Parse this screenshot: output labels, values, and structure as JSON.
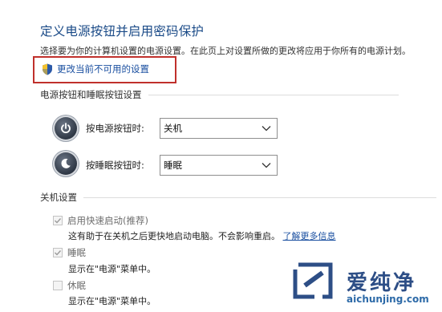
{
  "header": {
    "title": "定义电源按钮并启用密码保护",
    "subtitle": "选择要为你的计算机设置的电源设置。在此页上对设置所做的更改将应用于你所有的电源计划。",
    "change_link": "更改当前不可用的设置"
  },
  "power_buttons": {
    "section_title": "电源按钮和睡眠按钮设置",
    "rows": [
      {
        "label": "按电源按钮时:",
        "value": "关机"
      },
      {
        "label": "按睡眠按钮时:",
        "value": "睡眠"
      }
    ]
  },
  "shutdown": {
    "section_title": "关机设置",
    "options": [
      {
        "label": "启用快速启动(推荐)",
        "checked": true,
        "desc": "这有助于在关机之后更快地启动电脑。不会影响重启。",
        "link": "了解更多信息"
      },
      {
        "label": "睡眠",
        "checked": true,
        "desc": "显示在\"电源\"菜单中。"
      },
      {
        "label": "休眠",
        "checked": false,
        "desc": "显示在\"电源\"菜单中。"
      }
    ]
  },
  "watermark": {
    "text": "爱纯净",
    "url": "aichunjing.com"
  },
  "colors": {
    "title": "#1a4a87",
    "link": "#1a4fa0",
    "highlight_border": "#c0302c",
    "watermark": "#2d4e86"
  },
  "icons": [
    "shield-icon",
    "power-button-icon",
    "sleep-button-icon",
    "chevron-down-icon",
    "checkmark-icon"
  ]
}
